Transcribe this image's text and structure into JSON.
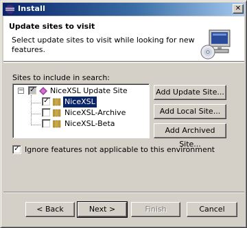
{
  "window": {
    "title": "Install"
  },
  "header": {
    "title": "Update sites to visit",
    "description": "Select update sites to visit while looking for new features.",
    "icon": "computer-cd-icon"
  },
  "sites": {
    "label": "Sites to include in search:",
    "tree": [
      {
        "label": "NiceXSL Update Site",
        "checked": "mixed",
        "expanded": true,
        "icon": "update-site-icon"
      },
      {
        "label": "NiceXSL",
        "checked": true,
        "selected": true,
        "icon": "feature-category-icon"
      },
      {
        "label": "NiceXSL-Archive",
        "checked": false,
        "icon": "feature-category-icon"
      },
      {
        "label": "NiceXSL-Beta",
        "checked": false,
        "icon": "feature-category-icon"
      }
    ]
  },
  "side_buttons": {
    "add_update_site": "Add Update Site...",
    "add_local_site": "Add Local Site...",
    "add_archived_site": "Add Archived Site..."
  },
  "ignore_option": {
    "label": "Ignore features not applicable to this environment",
    "checked": true
  },
  "nav": {
    "back": "< Back",
    "next": "Next >",
    "finish": "Finish",
    "cancel": "Cancel"
  }
}
